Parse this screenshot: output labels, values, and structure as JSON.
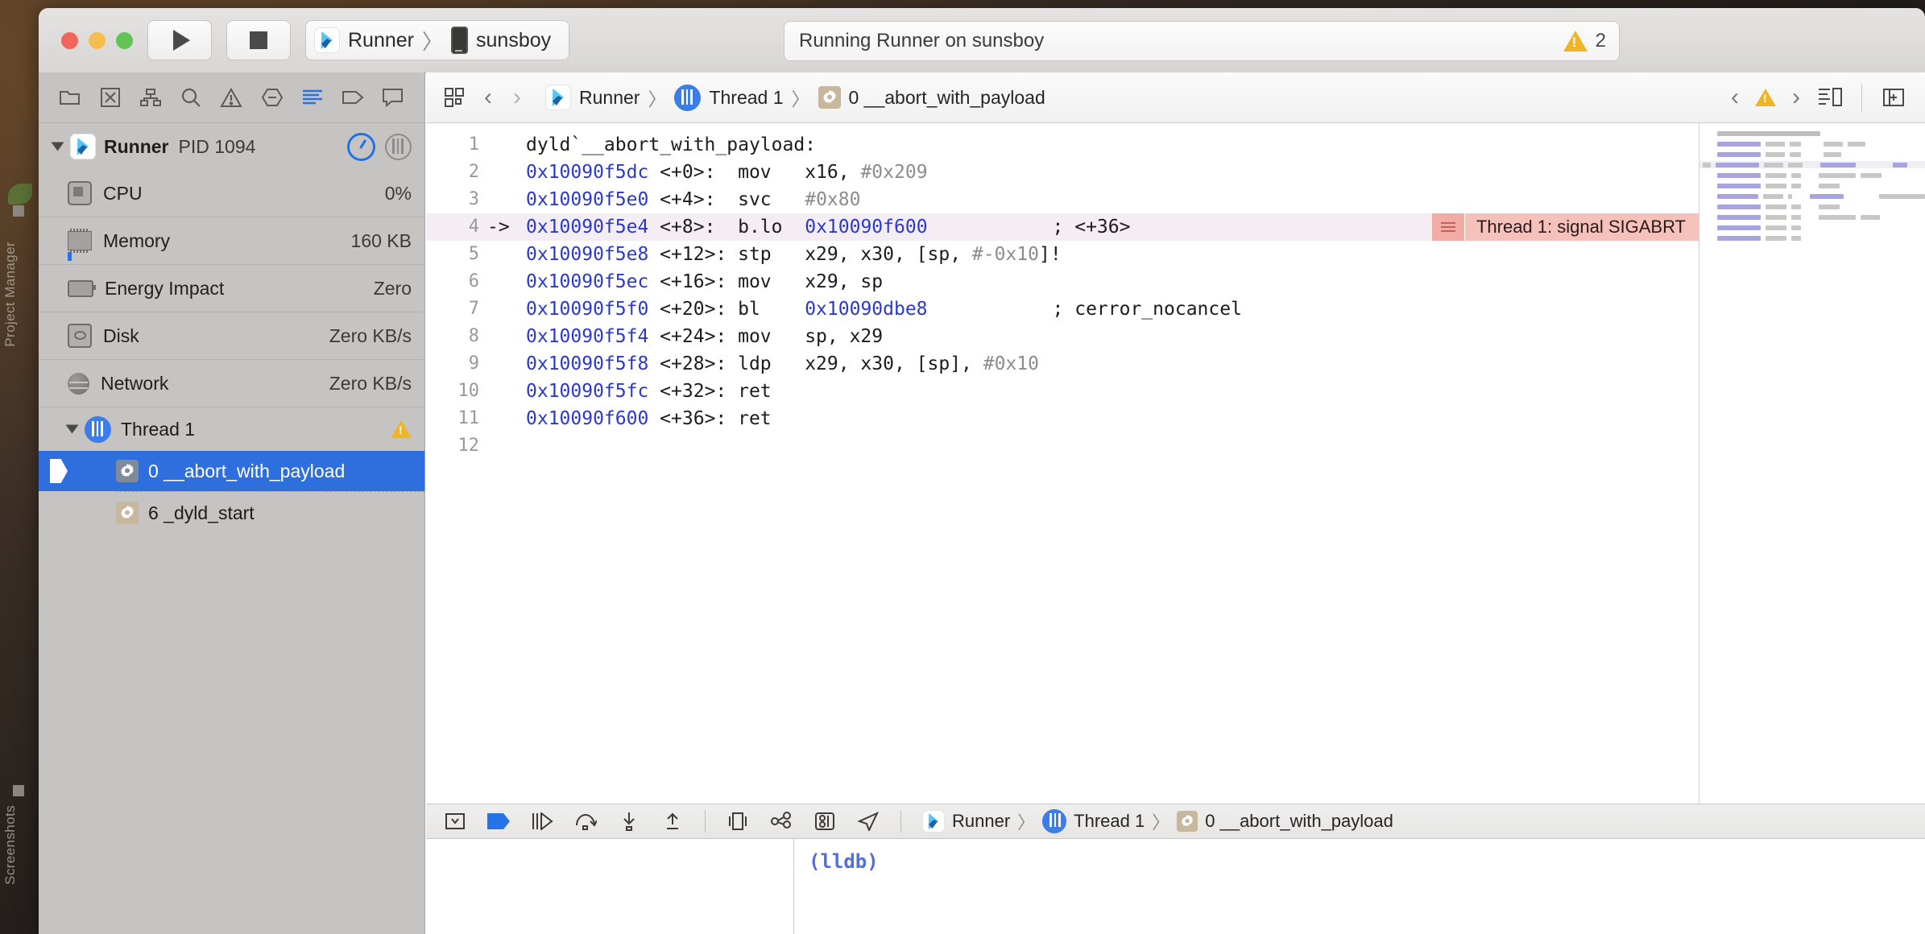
{
  "window": {
    "titlebar": {
      "traffic_lights": [
        "close",
        "minimize",
        "zoom"
      ],
      "run_button": "run-icon",
      "stop_button": "stop-icon",
      "scheme": "Runner",
      "scheme_separator": "〉",
      "destination": "sunsboy",
      "status_text": "Running Runner on sunsboy",
      "warning_count": "2"
    }
  },
  "navigator": {
    "toolbar_icons": [
      "project-navigator-icon",
      "test-navigator-icon",
      "hierarchy-navigator-icon",
      "find-navigator-icon",
      "issue-navigator-icon",
      "breakpoint-navigator-icon",
      "debug-navigator-icon",
      "tag-navigator-icon",
      "report-navigator-icon"
    ],
    "process": {
      "name": "Runner",
      "pid": "PID 1094",
      "gauge_icon": "gauge-icon",
      "thread_icon": "threads-icon"
    },
    "gauges": [
      {
        "label": "CPU",
        "value": "0%",
        "icon": "cpu-icon"
      },
      {
        "label": "Memory",
        "value": "160 KB",
        "icon": "memory-icon"
      },
      {
        "label": "Energy Impact",
        "value": "Zero",
        "icon": "energy-icon"
      },
      {
        "label": "Disk",
        "value": "Zero KB/s",
        "icon": "disk-icon"
      },
      {
        "label": "Network",
        "value": "Zero KB/s",
        "icon": "network-icon"
      }
    ],
    "thread": {
      "label": "Thread 1",
      "has_warning": true
    },
    "frames": [
      {
        "label": "0 __abort_with_payload",
        "selected": true,
        "icon": "frame-gear-icon"
      },
      {
        "label": "6 _dyld_start",
        "selected": false,
        "icon": "frame-gear-icon"
      }
    ]
  },
  "jumpbar": {
    "related_items_icon": "related-items-icon",
    "back_icon": "back-chevron-icon",
    "forward_icon": "forward-chevron-icon",
    "crumbs": [
      "Runner",
      "Thread 1",
      "0 __abort_with_payload"
    ],
    "separator": "〉",
    "prev_issue_icon": "previous-issue-icon",
    "issue_icon": "warning-icon",
    "next_issue_icon": "next-issue-icon",
    "assistant_editor_icon": "assistant-editor-icon",
    "add_editor_icon": "add-editor-icon"
  },
  "editor": {
    "lines": [
      {
        "num": "1",
        "pc": "",
        "text": "dyld`__abort_with_payload:",
        "kind": "label"
      },
      {
        "num": "2",
        "pc": "",
        "addr": "0x10090f5dc",
        "ofs": " <+0>:",
        "mnem": "  mov",
        "args": "   x16, ",
        "imm": "#0x209"
      },
      {
        "num": "3",
        "pc": "",
        "addr": "0x10090f5e0",
        "ofs": " <+4>:",
        "mnem": "  svc",
        "args": "   ",
        "imm": "#0x80"
      },
      {
        "num": "4",
        "pc": "->",
        "addr": "0x10090f5e4",
        "ofs": " <+8>:",
        "mnem": "  b.lo",
        "args": "  ",
        "target": "0x10090f600",
        "comment": "; <+36>",
        "current": true
      },
      {
        "num": "5",
        "pc": "",
        "addr": "0x10090f5e8",
        "ofs": " <+12>:",
        "mnem": " stp",
        "args": "   x29, x30, [sp, ",
        "imm": "#-0x10",
        "args2": "]!"
      },
      {
        "num": "6",
        "pc": "",
        "addr": "0x10090f5ec",
        "ofs": " <+16>:",
        "mnem": " mov",
        "args": "   x29, sp"
      },
      {
        "num": "7",
        "pc": "",
        "addr": "0x10090f5f0",
        "ofs": " <+20>:",
        "mnem": " bl",
        "args": "    ",
        "target": "0x10090dbe8",
        "comment": "; cerror_nocancel"
      },
      {
        "num": "8",
        "pc": "",
        "addr": "0x10090f5f4",
        "ofs": " <+24>:",
        "mnem": " mov",
        "args": "   sp, x29"
      },
      {
        "num": "9",
        "pc": "",
        "addr": "0x10090f5f8",
        "ofs": " <+28>:",
        "mnem": " ldp",
        "args": "   x29, x30, [sp], ",
        "imm": "#0x10"
      },
      {
        "num": "10",
        "pc": "",
        "addr": "0x10090f5fc",
        "ofs": " <+32>:",
        "mnem": " ret",
        "args": ""
      },
      {
        "num": "11",
        "pc": "",
        "addr": "0x10090f600",
        "ofs": " <+36>:",
        "mnem": " ret",
        "args": ""
      },
      {
        "num": "12",
        "pc": "",
        "text": "",
        "kind": "blank"
      }
    ],
    "signal_banner": {
      "icon": "issue-list-icon",
      "text": "Thread 1: signal SIGABRT"
    }
  },
  "debugbar": {
    "icons": [
      "hide-console-icon",
      "breakpoints-active-icon",
      "continue-icon",
      "step-over-icon",
      "step-into-icon",
      "step-out-icon",
      "view-hierarchy-icon",
      "memory-graph-icon",
      "environment-overrides-icon",
      "simulate-location-icon"
    ],
    "crumbs": [
      "Runner",
      "Thread 1",
      "0 __abort_with_payload"
    ],
    "separator": "〉"
  },
  "console": {
    "prompt": "(lldb)"
  },
  "colors": {
    "accent_blue": "#2f6fdd",
    "address_blue": "#2b39c8",
    "warning_yellow": "#f0b429",
    "signal_pink": "#f6c0bb",
    "signal_pink_dark": "#f2aca6",
    "current_line": "#f4eef4"
  },
  "desktop": {
    "labels": [
      "Project Manager",
      "Screenshots"
    ]
  }
}
